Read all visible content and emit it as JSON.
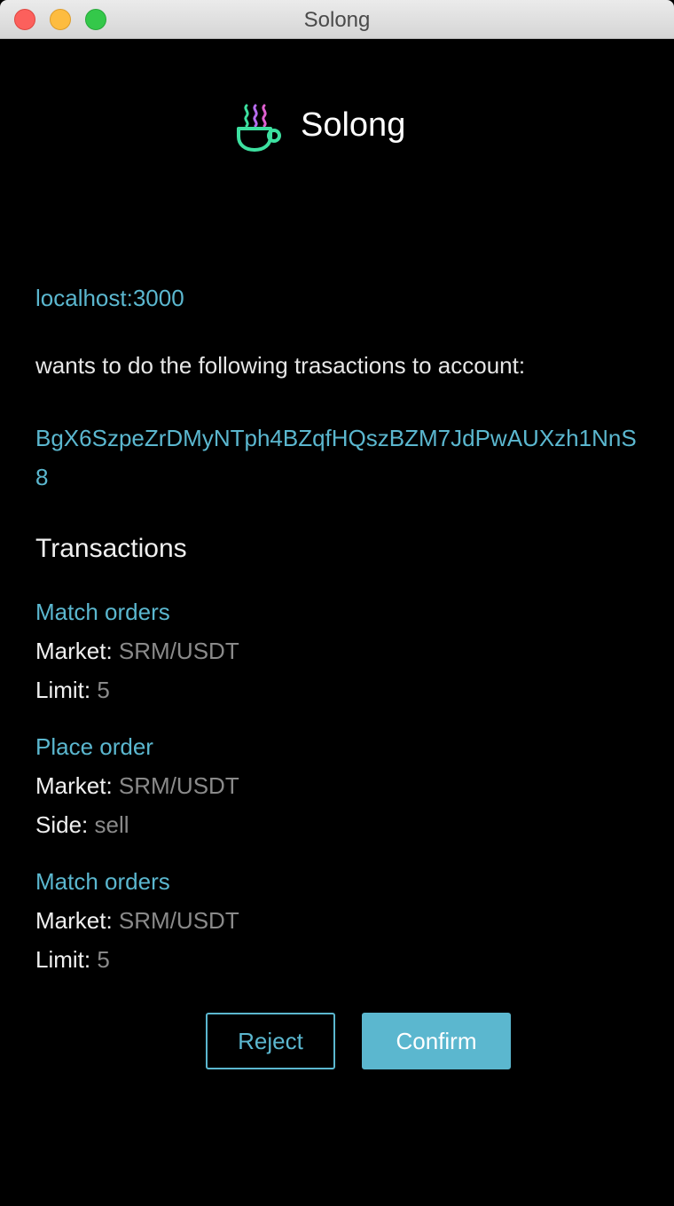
{
  "window": {
    "title": "Solong"
  },
  "header": {
    "brand": "Solong",
    "logo_icon": "coffee-cup-icon",
    "logo_colors": [
      "#3de0a0",
      "#b86cf0",
      "#e060d0"
    ]
  },
  "request": {
    "origin": "localhost:3000",
    "intro": "wants to do the following trasactions to account:",
    "account": "BgX6SzpeZrDMyNTph4BZqfHQszBZM7JdPwAUXzh1NnS8"
  },
  "transactions": {
    "heading": "Transactions",
    "items": [
      {
        "title": "Match orders",
        "fields": [
          {
            "label": "Market:",
            "value": "SRM/USDT"
          },
          {
            "label": "Limit:",
            "value": "5"
          }
        ]
      },
      {
        "title": "Place order",
        "fields": [
          {
            "label": "Market:",
            "value": "SRM/USDT"
          },
          {
            "label": "Side:",
            "value": "sell"
          }
        ]
      },
      {
        "title": "Match orders",
        "fields": [
          {
            "label": "Market:",
            "value": "SRM/USDT"
          },
          {
            "label": "Limit:",
            "value": "5"
          }
        ]
      }
    ]
  },
  "actions": {
    "reject_label": "Reject",
    "confirm_label": "Confirm"
  },
  "colors": {
    "accent": "#5bb7cf",
    "background": "#000000",
    "muted_value": "#8a8a8a"
  }
}
